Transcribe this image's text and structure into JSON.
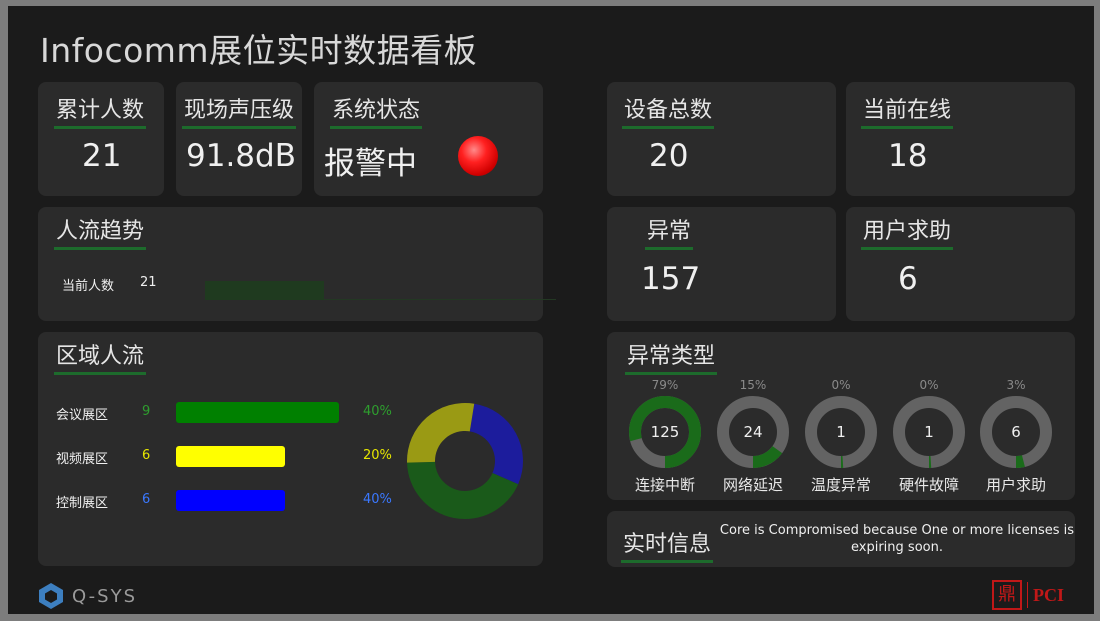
{
  "title": "Infocomm展位实时数据看板",
  "stats": {
    "total_visitors": {
      "label": "累计人数",
      "value": "21"
    },
    "sound_level": {
      "label": "现场声压级",
      "value": "91.8dB"
    },
    "system_status": {
      "label": "系统状态",
      "value": "报警中",
      "indicator_color": "#ff1f1f"
    },
    "device_total": {
      "label": "设备总数",
      "value": "20"
    },
    "online_now": {
      "label": "当前在线",
      "value": "18"
    },
    "abnormal": {
      "label": "异常",
      "value": "157"
    },
    "help_requests": {
      "label": "用户求助",
      "value": "6"
    }
  },
  "trend": {
    "label": "人流趋势",
    "row_label": "当前人数",
    "row_value": "21",
    "fill_fraction": 0.34,
    "fill_color": "#1f3a1f"
  },
  "zones": {
    "label": "区域人流",
    "items": [
      {
        "name": "会议展区",
        "count": "9",
        "pct": "40%",
        "bar_fraction": 1.0,
        "color": "#008000",
        "text_color": "#2e9e2e"
      },
      {
        "name": "视频展区",
        "count": "6",
        "pct": "20%",
        "bar_fraction": 0.667,
        "color": "#ffff00",
        "text_color": "#e6e600"
      },
      {
        "name": "控制展区",
        "count": "6",
        "pct": "40%",
        "bar_fraction": 0.667,
        "color": "#0000ff",
        "text_color": "#3a78ff"
      }
    ],
    "donut": [
      {
        "value": 29,
        "color": "#1c1c9c"
      },
      {
        "value": 43,
        "color": "#1a5a1a"
      },
      {
        "value": 28,
        "color": "#9a9a14"
      }
    ]
  },
  "abnormal_types": {
    "label": "异常类型",
    "gauges": [
      {
        "pct": "79%",
        "fraction": 0.79,
        "count": "125",
        "name": "连接中断"
      },
      {
        "pct": "15%",
        "fraction": 0.15,
        "count": "24",
        "name": "网络延迟"
      },
      {
        "pct": "0%",
        "fraction": 0.01,
        "count": "1",
        "name": "温度异常"
      },
      {
        "pct": "0%",
        "fraction": 0.01,
        "count": "1",
        "name": "硬件故障"
      },
      {
        "pct": "3%",
        "fraction": 0.04,
        "count": "6",
        "name": "用户求助"
      }
    ],
    "track_color": "#636363",
    "fill_color": "#1a6b1a"
  },
  "realtime": {
    "label": "实时信息",
    "message": "Core is Compromised because One or more licenses is expiring soon."
  },
  "branding": {
    "left_logo_text": "Q-SYS",
    "right_seal": "鼎",
    "right_text": "PCI"
  }
}
